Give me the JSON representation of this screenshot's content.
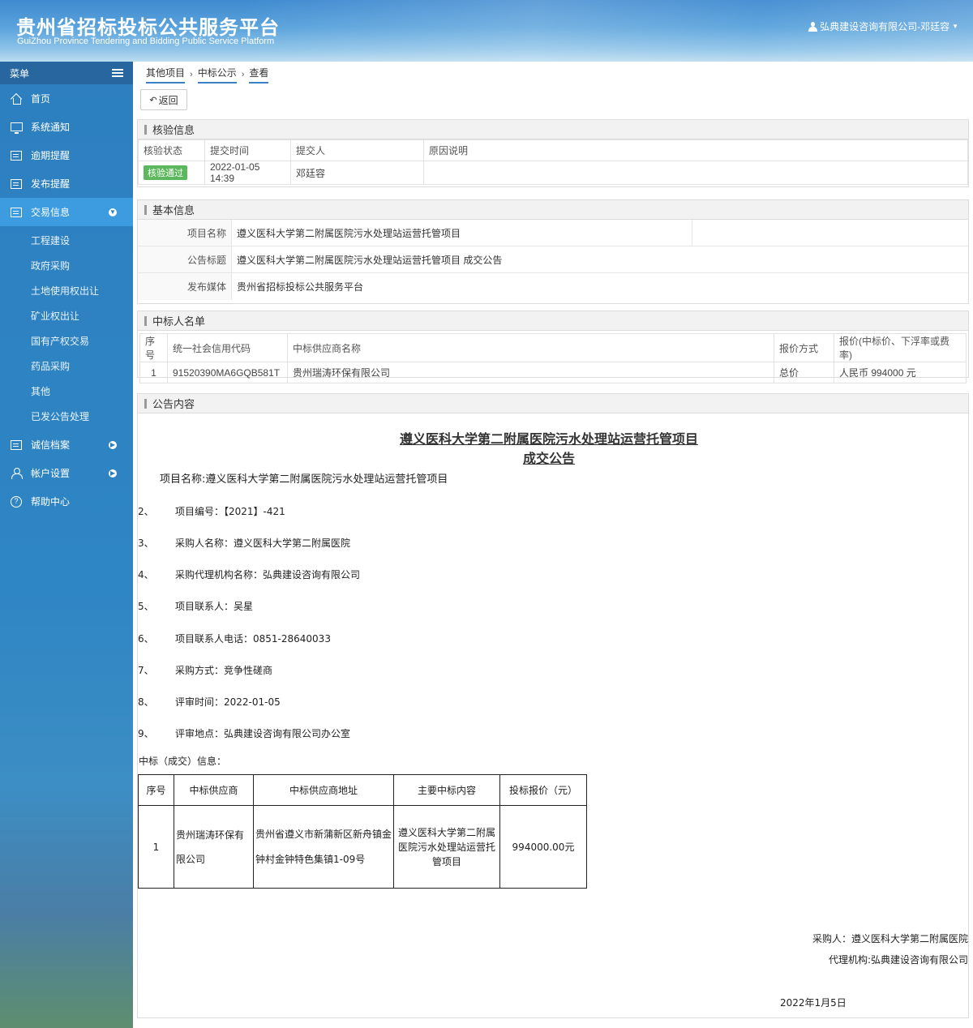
{
  "header": {
    "title_cn": "贵州省招标投标公共服务平台",
    "title_en": "GuiZhou Province Tendering and Bidding Public Service Platform",
    "user": "弘典建设咨询有限公司-邓廷容"
  },
  "sidebar": {
    "menu_label": "菜单",
    "items": [
      {
        "label": "首页"
      },
      {
        "label": "系统通知"
      },
      {
        "label": "逾期提醒"
      },
      {
        "label": "发布提醒"
      },
      {
        "label": "交易信息"
      }
    ],
    "sub_items": [
      "工程建设",
      "政府采购",
      "土地使用权出让",
      "矿业权出让",
      "国有产权交易",
      "药品采购",
      "其他",
      "已发公告处理"
    ],
    "bottom_items": [
      {
        "label": "诚信档案"
      },
      {
        "label": "帐户设置"
      },
      {
        "label": "帮助中心"
      }
    ]
  },
  "breadcrumb": [
    "其他项目",
    "中标公示",
    "查看"
  ],
  "back_button": "返回",
  "verify": {
    "title": "核验信息",
    "headers": [
      "核验状态",
      "提交时间",
      "提交人",
      "原因说明"
    ],
    "status": "核验通过",
    "time": "2022-01-05 14:39",
    "submitter": "邓廷容",
    "reason": ""
  },
  "basic": {
    "title": "基本信息",
    "rows": [
      {
        "key": "项目名称",
        "value": "遵义医科大学第二附属医院污水处理站运营托管项目"
      },
      {
        "key": "公告标题",
        "value": "遵义医科大学第二附属医院污水处理站运营托管项目 成交公告"
      },
      {
        "key": "发布媒体",
        "value": "贵州省招标投标公共服务平台"
      }
    ]
  },
  "winners": {
    "title": "中标人名单",
    "headers": [
      "序号",
      "统一社会信用代码",
      "中标供应商名称",
      "报价方式",
      "报价(中标价、下浮率或费率)"
    ],
    "rows": [
      {
        "no": "1",
        "code": "91520390MA6GQB581T",
        "name": "贵州瑞涛环保有限公司",
        "method": "总价",
        "price": "人民币 994000 元"
      }
    ]
  },
  "notice": {
    "title": "公告内容",
    "heading1": "遵义医科大学第二附属医院污水处理站运营托管项目",
    "heading2": "成交公告",
    "line1": "项目名称:遵义医科大学第二附属医院污水处理站运营托管项目",
    "items": [
      {
        "num": "2、",
        "text": "项目编号：【2021】-421"
      },
      {
        "num": "3、",
        "text": "采购人名称：遵义医科大学第二附属医院"
      },
      {
        "num": "4、",
        "text": "采购代理机构名称：弘典建设咨询有限公司"
      },
      {
        "num": "5、",
        "text": "项目联系人：吴星"
      },
      {
        "num": "6、",
        "text": "项目联系人电话：0851-28640033"
      },
      {
        "num": "7、",
        "text": "采购方式：竞争性磋商"
      },
      {
        "num": "8、",
        "text": "评审时间：2022-01-05"
      },
      {
        "num": "9、",
        "text": "评审地点：弘典建设咨询有限公司办公室"
      }
    ],
    "award_label": "中标（成交）信息：",
    "award_headers": [
      "序号",
      "中标供应商",
      "中标供应商地址",
      "主要中标内容",
      "投标报价（元）"
    ],
    "award_row": {
      "no": "1",
      "supplier": "贵州瑞涛环保有限公司",
      "address": "贵州省遵义市新蒲新区新舟镇金钟村金钟特色集镇1-09号",
      "content": "遵义医科大学第二附属医院污水处理站运营托管项目",
      "price": "994000.00元"
    },
    "buyer": "采购人：遵义医科大学第二附属医院",
    "agency": "代理机构:弘典建设咨询有限公司",
    "date": "2022年1月5日"
  }
}
